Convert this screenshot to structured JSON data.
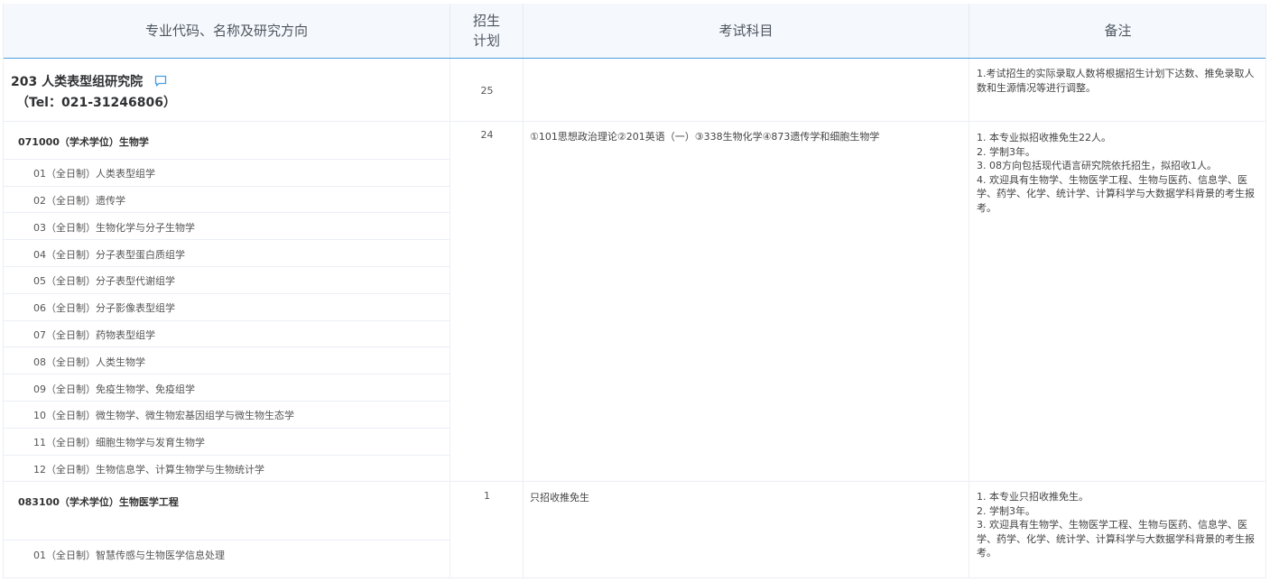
{
  "table": {
    "headers": {
      "major": "专业代码、名称及研究方向",
      "plan": "招生计划",
      "plan_line1": "招生",
      "plan_line2": "计划",
      "exam": "考试科目",
      "notes": "备注"
    }
  },
  "institute": {
    "name": "203 人类表型组研究院",
    "tel": "（Tel：021-31246806）",
    "plan": "25",
    "exam": "",
    "note": "1.考试招生的实际录取人数将根据招生计划下达数、推免录取人数和生源情况等进行调整。",
    "icon": "message-icon",
    "accent_color": "#4a9fe0"
  },
  "majors": [
    {
      "title": "071000（学术学位）生物学",
      "plan": "24",
      "exam": "①101思想政治理论②201英语（一）③338生物化学④873遗传学和细胞生物学",
      "notes": [
        "1. 本专业拟招收推免生22人。",
        "2. 学制3年。",
        "3. 08方向包括现代语言研究院依托招生，拟招收1人。",
        "4. 欢迎具有生物学、生物医学工程、生物与医药、信息学、医学、药学、化学、统计学、计算科学与大数据学科背景的考生报考。"
      ],
      "directions": [
        "01（全日制）人类表型组学",
        "02（全日制）遗传学",
        "03（全日制）生物化学与分子生物学",
        "04（全日制）分子表型蛋白质组学",
        "05（全日制）分子表型代谢组学",
        "06（全日制）分子影像表型组学",
        "07（全日制）药物表型组学",
        "08（全日制）人类生物学",
        "09（全日制）免疫生物学、免疫组学",
        "10（全日制）微生物学、微生物宏基因组学与微生物生态学",
        "11（全日制）细胞生物学与发育生物学",
        "12（全日制）生物信息学、计算生物学与生物统计学"
      ]
    },
    {
      "title": "083100（学术学位）生物医学工程",
      "plan": "1",
      "exam": "只招收推免生",
      "notes": [
        "1. 本专业只招收推免生。",
        "2. 学制3年。",
        "3. 欢迎具有生物学、生物医学工程、生物与医药、信息学、医学、药学、化学、统计学、计算科学与大数据学科背景的考生报考。"
      ],
      "directions": [
        "01（全日制）智慧传感与生物医学信息处理"
      ]
    }
  ]
}
